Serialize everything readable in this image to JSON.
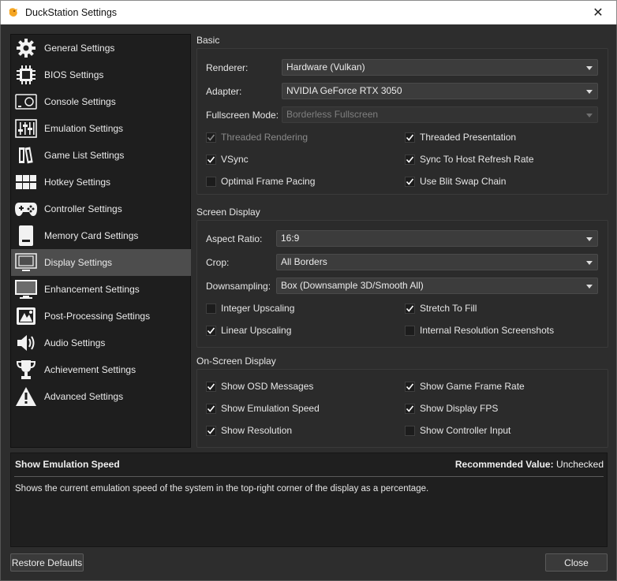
{
  "window": {
    "title": "DuckStation Settings",
    "close_glyph": "✕"
  },
  "sidebar": {
    "items": [
      {
        "label": "General Settings",
        "icon": "gear-icon"
      },
      {
        "label": "BIOS Settings",
        "icon": "chip-icon"
      },
      {
        "label": "Console Settings",
        "icon": "console-icon"
      },
      {
        "label": "Emulation Settings",
        "icon": "sliders-icon"
      },
      {
        "label": "Game List Settings",
        "icon": "books-icon"
      },
      {
        "label": "Hotkey Settings",
        "icon": "keyboard-icon"
      },
      {
        "label": "Controller Settings",
        "icon": "gamepad-icon"
      },
      {
        "label": "Memory Card Settings",
        "icon": "memory-card-icon"
      },
      {
        "label": "Display Settings",
        "icon": "monitor-icon",
        "active": true
      },
      {
        "label": "Enhancement Settings",
        "icon": "enhanced-monitor-icon"
      },
      {
        "label": "Post-Processing Settings",
        "icon": "image-effects-icon"
      },
      {
        "label": "Audio Settings",
        "icon": "speaker-icon"
      },
      {
        "label": "Achievement Settings",
        "icon": "trophy-icon"
      },
      {
        "label": "Advanced Settings",
        "icon": "warning-icon"
      }
    ]
  },
  "basic": {
    "title": "Basic",
    "renderer": {
      "label": "Renderer:",
      "value": "Hardware (Vulkan)"
    },
    "adapter": {
      "label": "Adapter:",
      "value": "NVIDIA GeForce RTX 3050"
    },
    "fullscreen": {
      "label": "Fullscreen Mode:",
      "value": "Borderless Fullscreen",
      "disabled": true
    },
    "checks": [
      {
        "label": "Threaded Rendering",
        "checked": true,
        "disabled": true
      },
      {
        "label": "Threaded Presentation",
        "checked": true
      },
      {
        "label": "VSync",
        "checked": true
      },
      {
        "label": "Sync To Host Refresh Rate",
        "checked": true
      },
      {
        "label": "Optimal Frame Pacing",
        "checked": false
      },
      {
        "label": "Use Blit Swap Chain",
        "checked": true
      }
    ]
  },
  "screen": {
    "title": "Screen Display",
    "aspect": {
      "label": "Aspect Ratio:",
      "value": "16:9"
    },
    "crop": {
      "label": "Crop:",
      "value": "All Borders"
    },
    "downsampling": {
      "label": "Downsampling:",
      "value": "Box (Downsample 3D/Smooth All)"
    },
    "checks": [
      {
        "label": "Integer Upscaling",
        "checked": false
      },
      {
        "label": "Stretch To Fill",
        "checked": true
      },
      {
        "label": "Linear Upscaling",
        "checked": true
      },
      {
        "label": "Internal Resolution Screenshots",
        "checked": false
      }
    ]
  },
  "osd": {
    "title": "On-Screen Display",
    "checks": [
      {
        "label": "Show OSD Messages",
        "checked": true
      },
      {
        "label": "Show Game Frame Rate",
        "checked": true
      },
      {
        "label": "Show Emulation Speed",
        "checked": true
      },
      {
        "label": "Show Display FPS",
        "checked": true
      },
      {
        "label": "Show Resolution",
        "checked": true
      },
      {
        "label": "Show Controller Input",
        "checked": false
      }
    ]
  },
  "description": {
    "title": "Show Emulation Speed",
    "recommended_label": "Recommended Value:",
    "recommended_value": "Unchecked",
    "text": "Shows the current emulation speed of the system in the top-right corner of the display as a percentage."
  },
  "buttons": {
    "restore": "Restore Defaults",
    "close": "Close"
  },
  "colors": {
    "accent_active": "#4d4d4d",
    "background": "#2d2d2d",
    "sidebar": "#1e1e1e"
  }
}
